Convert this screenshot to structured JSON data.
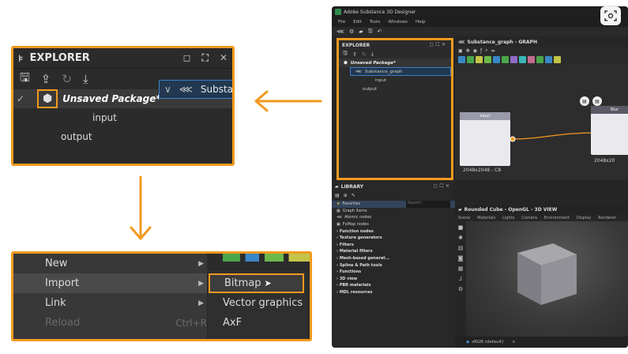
{
  "zoom_explorer": {
    "title": "EXPLORER",
    "package_label": "Unsaved Package*",
    "graph_label": "Substance_graph",
    "input_label": "input",
    "output_label": "output"
  },
  "zoom_menu": {
    "items": [
      {
        "label": "New"
      },
      {
        "label": "Import"
      },
      {
        "label": "Link"
      },
      {
        "label": "Reload",
        "shortcut": "Ctrl+R"
      }
    ],
    "submenu": [
      {
        "label": "Bitmap"
      },
      {
        "label": "Vector graphics"
      },
      {
        "label": "AxF"
      }
    ]
  },
  "app": {
    "title": "Adobe Substance 3D Designer",
    "menus": [
      "File",
      "Edit",
      "Tools",
      "Windows",
      "Help"
    ],
    "explorer": {
      "title": "EXPLORER",
      "package_label": "Unsaved Package*",
      "graph_label": "Substance_graph",
      "input_label": "input",
      "output_label": "output"
    },
    "graph": {
      "title": "Substance_graph - GRAPH",
      "node_input": "input",
      "node_input_caption": "2048x2048 - C8",
      "node_blur": "Blur",
      "node_blur_caption": "2048x20"
    },
    "library": {
      "title": "LIBRARY",
      "search_placeholder": "Search",
      "items": [
        "Favorites",
        "Graph items",
        "Atomic nodes",
        "FxMap nodes"
      ],
      "categories": [
        "Function nodes",
        "Texture generators",
        "Filters",
        "Material filters",
        "Mesh-based generat...",
        "Spline & Path tools",
        "Functions",
        "3D view",
        "PBR materials",
        "MDL resources"
      ]
    },
    "view3d": {
      "title": "Rounded Cube - OpenGL - 3D VIEW",
      "tabs": [
        "Scene",
        "Materials",
        "Lights",
        "Camera",
        "Environment",
        "Display",
        "Renderer"
      ],
      "colorspace": "sRGB (default)"
    }
  },
  "colors": {
    "highlight": "#f39a1e",
    "selection": "#3f7fc6",
    "panel": "#2b2b2b"
  }
}
